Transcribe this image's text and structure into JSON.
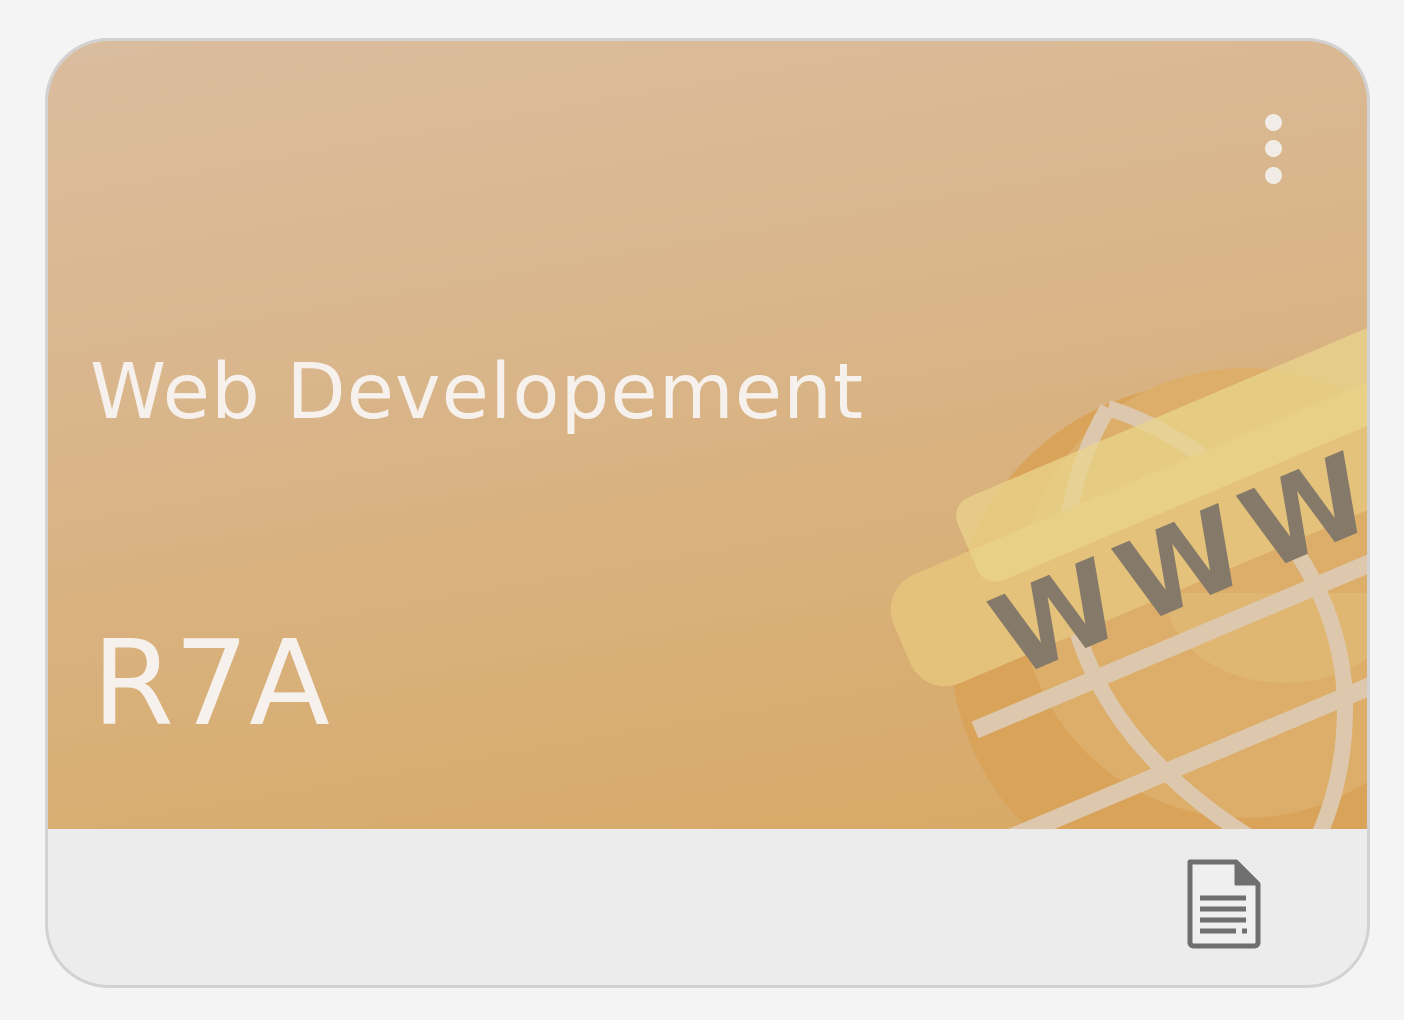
{
  "card": {
    "title": "Web Developement",
    "section": "R7A",
    "banner_gradient": [
      "#dabd9f",
      "#d9b58a",
      "#d8a964"
    ],
    "text_color": "#f6f1ec",
    "footer_color": "#ececec"
  },
  "illustration": {
    "icon": "globe-www-icon",
    "label": "WWW"
  },
  "actions": {
    "menu_icon": "more-vertical-icon",
    "document_icon": "document-icon"
  }
}
